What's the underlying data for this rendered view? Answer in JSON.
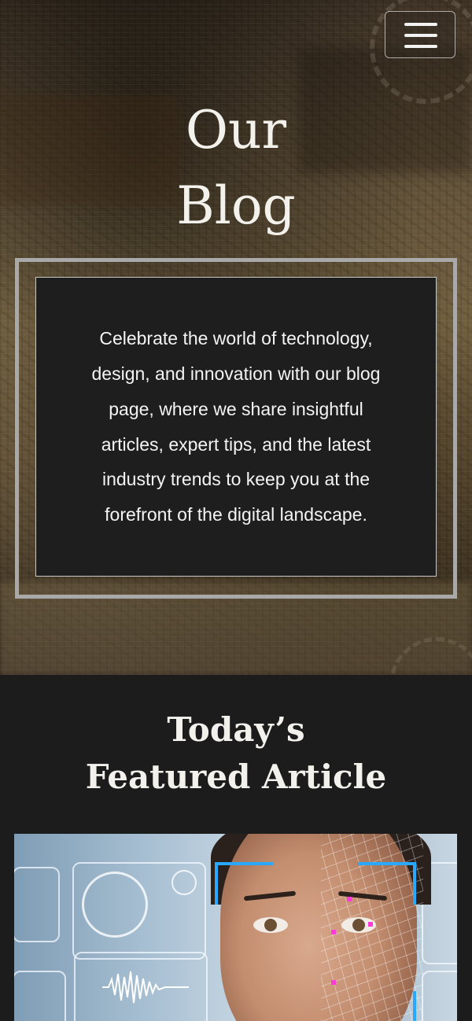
{
  "hero": {
    "title_line1": "Our",
    "title_line2": "Blog",
    "description": "Celebrate the world of technology, design, and innovation with our blog page, where we share insightful articles, expert tips, and the latest industry trends to keep you at the forefront of the digital landscape."
  },
  "nav": {
    "menu_icon": "hamburger-menu-icon"
  },
  "featured": {
    "title_line1": "Today’s",
    "title_line2": "Featured Article",
    "image_subject": "woman face with digital biometric scan mesh and HUD interface"
  },
  "colors": {
    "page_background": "#1c1c1c",
    "text_light": "#f3f1ec",
    "frame_border": "#a9a9a9",
    "card_background": "#1e1e1e",
    "hud_accent": "#29a8ff"
  }
}
